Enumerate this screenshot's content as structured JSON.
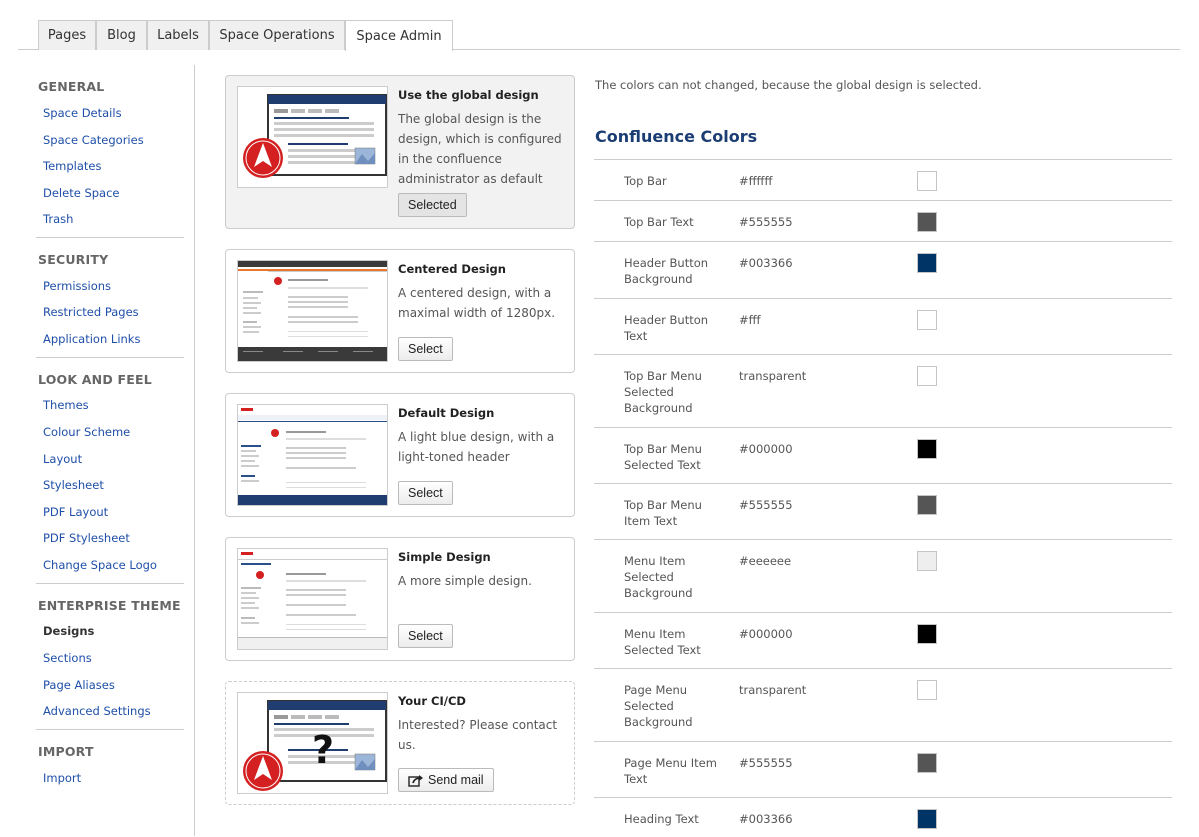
{
  "tabs": [
    {
      "label": "Pages"
    },
    {
      "label": "Blog"
    },
    {
      "label": "Labels"
    },
    {
      "label": "Space Operations"
    },
    {
      "label": "Space Admin"
    }
  ],
  "sidebar": {
    "general": {
      "heading": "GENERAL",
      "items": [
        "Space Details",
        "Space Categories",
        "Templates",
        "Delete Space",
        "Trash"
      ]
    },
    "security": {
      "heading": "SECURITY",
      "items": [
        "Permissions",
        "Restricted Pages",
        "Application Links"
      ]
    },
    "look": {
      "heading": "LOOK AND FEEL",
      "items": [
        "Themes",
        "Colour Scheme",
        "Layout",
        "Stylesheet",
        "PDF Layout",
        "PDF Stylesheet",
        "Change Space Logo"
      ]
    },
    "enterprise": {
      "heading": "ENTERPRISE THEME",
      "items": [
        "Designs",
        "Sections",
        "Page Aliases",
        "Advanced Settings"
      ]
    },
    "import": {
      "heading": "IMPORT",
      "items": [
        "Import"
      ]
    }
  },
  "designs": [
    {
      "title": "Use the global design",
      "desc": "The global design is the design, which is configured in the confluence administrator as default",
      "button": "Selected"
    },
    {
      "title": "Centered Design",
      "desc": "A centered design, with a maximal width of 1280px.",
      "button": "Select"
    },
    {
      "title": "Default Design",
      "desc": "A light blue design, with a light-toned header",
      "button": "Select"
    },
    {
      "title": "Simple Design",
      "desc": "A more simple design.",
      "button": "Select"
    },
    {
      "title": "Your CI/CD",
      "desc": "Interested? Please contact us.",
      "button": "Send mail",
      "button_icon": "share-icon"
    }
  ],
  "colors_panel": {
    "note": "The colors can not changed, because the global design is selected.",
    "heading": "Confluence Colors",
    "rows": [
      {
        "label": "Top Bar",
        "value": "#ffffff",
        "color": "#ffffff"
      },
      {
        "label": "Top Bar Text",
        "value": "#555555",
        "color": "#555555"
      },
      {
        "label": "Header Button Background",
        "value": "#003366",
        "color": "#003366"
      },
      {
        "label": "Header Button Text",
        "value": "#fff",
        "color": "#ffffff"
      },
      {
        "label": "Top Bar Menu Selected Background",
        "value": "transparent",
        "color": "#ffffff"
      },
      {
        "label": "Top Bar Menu Selected Text",
        "value": "#000000",
        "color": "#000000"
      },
      {
        "label": "Top Bar Menu Item Text",
        "value": "#555555",
        "color": "#555555"
      },
      {
        "label": "Menu Item Selected Background",
        "value": "#eeeeee",
        "color": "#eeeeee"
      },
      {
        "label": "Menu Item Selected Text",
        "value": "#000000",
        "color": "#000000"
      },
      {
        "label": "Page Menu Selected Background",
        "value": "transparent",
        "color": "#ffffff"
      },
      {
        "label": "Page Menu Item Text",
        "value": "#555555",
        "color": "#555555"
      },
      {
        "label": "Heading Text",
        "value": "#003366",
        "color": "#003366"
      }
    ]
  },
  "colors": {
    "link": "#1f4fa8",
    "heading_blue": "#1b3d73",
    "brand_red": "#d42020"
  }
}
